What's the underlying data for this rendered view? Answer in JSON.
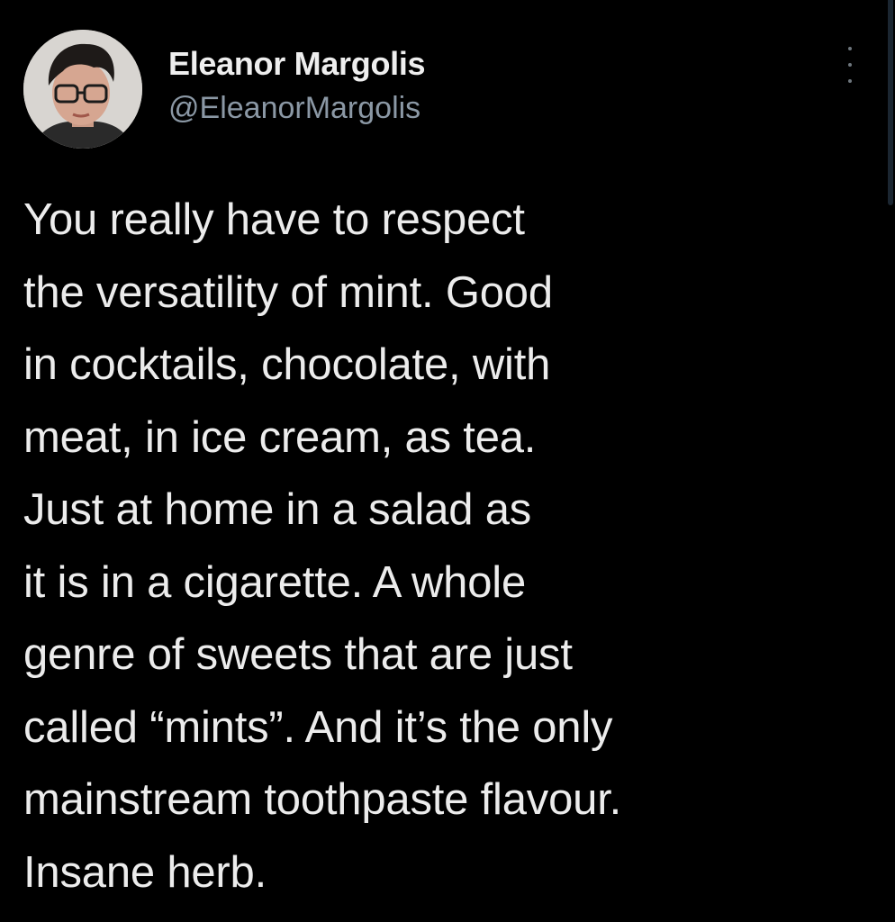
{
  "author": {
    "display_name": "Eleanor Margolis",
    "handle": "@EleanorMargolis",
    "avatar_icon": "person-photo-avatar"
  },
  "menu": {
    "icon": "more-vertical-icon"
  },
  "tweet": {
    "lines": [
      "You really have to respect",
      "the versatility of mint. Good",
      "in cocktails, chocolate, with",
      "meat, in ice cream, as tea.",
      "Just at home in a salad as",
      "it is in a cigarette. A whole",
      "genre of sweets that are just",
      "called “mints”. And it’s the only",
      "mainstream toothpaste flavour.",
      "Insane herb."
    ]
  },
  "colors": {
    "background": "#000000",
    "text": "#ececec",
    "handle": "#8b98a5"
  }
}
